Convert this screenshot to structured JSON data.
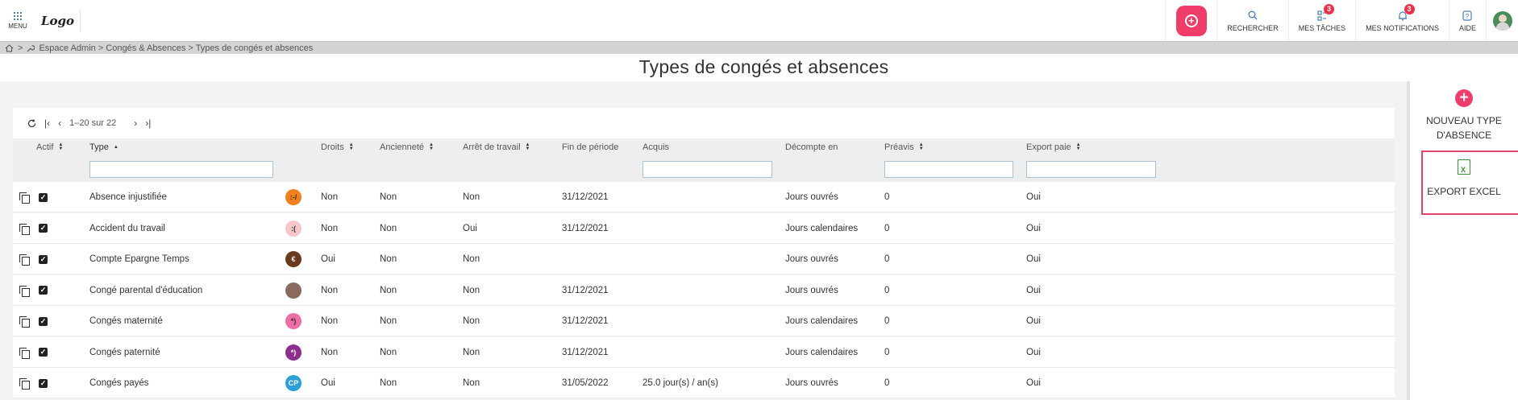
{
  "topbar": {
    "menu_label": "MENU",
    "logo_text": "Logo",
    "search_label": "RECHERCHER",
    "tasks_label": "MES TÂCHES",
    "tasks_count": "3",
    "notifications_label": "MES NOTIFICATIONS",
    "notifications_count": "3",
    "help_label": "AIDE"
  },
  "breadcrumb": {
    "sep1": ">",
    "path": "Espace Admin > Congés & Absences > Types de congés et absences"
  },
  "page_title": "Types de congés et absences",
  "pager": {
    "range": "1–20 sur 22"
  },
  "columns": {
    "actif": "Actif",
    "type": "Type",
    "droits": "Droits",
    "anciennete": "Ancienneté",
    "arret": "Arrêt de travail",
    "fin_periode": "Fin de période",
    "acquis": "Acquis",
    "decompte": "Décompte en",
    "preavis": "Préavis",
    "export_paie": "Export paie"
  },
  "rows": [
    {
      "type": "Absence injustifiée",
      "icon_text": ":-/",
      "icon_color": "#f07f1d",
      "droits": "Non",
      "anciennete": "Non",
      "arret": "Non",
      "fin": "31/12/2021",
      "acquis": "",
      "decompte": "Jours ouvrés",
      "preavis": "0",
      "export": "Oui"
    },
    {
      "type": "Accident du travail",
      "icon_text": ":(",
      "icon_color": "#f7c6c6",
      "droits": "Non",
      "anciennete": "Non",
      "arret": "Oui",
      "fin": "31/12/2021",
      "acquis": "",
      "decompte": "Jours calendaires",
      "preavis": "0",
      "export": "Oui"
    },
    {
      "type": "Compte Epargne Temps",
      "icon_text": "€",
      "icon_color": "#6b3a1e",
      "droits": "Oui",
      "anciennete": "Non",
      "arret": "Non",
      "fin": "",
      "acquis": "",
      "decompte": "Jours ouvrés",
      "preavis": "0",
      "export": "Oui"
    },
    {
      "type": "Congé parental d'éducation",
      "icon_text": "",
      "icon_color": "#8a6a5e",
      "droits": "Non",
      "anciennete": "Non",
      "arret": "Non",
      "fin": "31/12/2021",
      "acquis": "",
      "decompte": "Jours ouvrés",
      "preavis": "0",
      "export": "Oui"
    },
    {
      "type": "Congés maternité",
      "icon_text": "*)",
      "icon_color": "#ee6fa6",
      "droits": "Non",
      "anciennete": "Non",
      "arret": "Non",
      "fin": "31/12/2021",
      "acquis": "",
      "decompte": "Jours calendaires",
      "preavis": "0",
      "export": "Oui"
    },
    {
      "type": "Congés paternité",
      "icon_text": "*)",
      "icon_color": "#8e2f8e",
      "droits": "Non",
      "anciennete": "Non",
      "arret": "Non",
      "fin": "31/12/2021",
      "acquis": "",
      "decompte": "Jours calendaires",
      "preavis": "0",
      "export": "Oui"
    },
    {
      "type": "Congés payés",
      "icon_text": "CP",
      "icon_color": "#2a9fd8",
      "droits": "Oui",
      "anciennete": "Non",
      "arret": "Non",
      "fin": "31/05/2022",
      "acquis": "25.0 jour(s) / an(s)",
      "decompte": "Jours ouvrés",
      "preavis": "0",
      "export": "Oui"
    }
  ],
  "sidebar": {
    "new_type_label": "NOUVEAU TYPE D'ABSENCE",
    "export_excel_label": "EXPORT EXCEL"
  },
  "colors": {
    "accent": "#ef3d6a",
    "badge": "#e8334a",
    "excel_green": "#3a8f3a"
  }
}
